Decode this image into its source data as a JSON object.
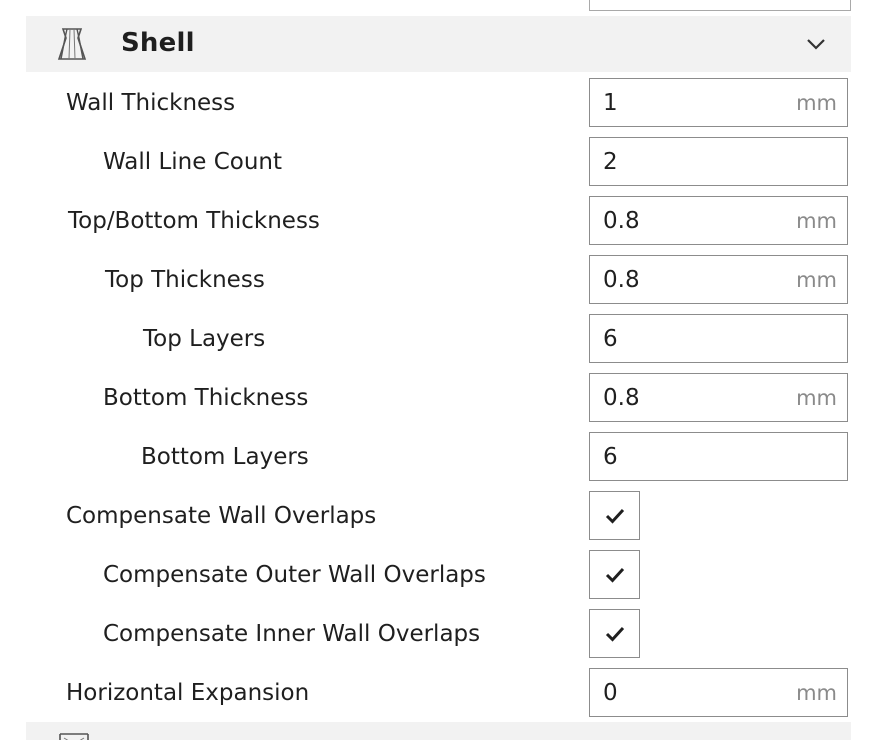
{
  "section": {
    "title": "Shell",
    "icon": "shell-icon",
    "expanded": true
  },
  "settings": [
    {
      "label": "Wall Thickness",
      "level": 0,
      "type": "number",
      "value": "1",
      "unit": "mm"
    },
    {
      "label": "Wall Line Count",
      "level": 1,
      "type": "number",
      "value": "2",
      "unit": ""
    },
    {
      "label": "Top/Bottom Thickness",
      "level": 0,
      "type": "number",
      "value": "0.8",
      "unit": "mm"
    },
    {
      "label": "Top Thickness",
      "level": 1,
      "type": "number",
      "value": "0.8",
      "unit": "mm"
    },
    {
      "label": "Top Layers",
      "level": 2,
      "type": "number",
      "value": "6",
      "unit": ""
    },
    {
      "label": "Bottom Thickness",
      "level": 1,
      "type": "number",
      "value": "0.8",
      "unit": "mm"
    },
    {
      "label": "Bottom Layers",
      "level": 2,
      "type": "number",
      "value": "6",
      "unit": ""
    },
    {
      "label": "Compensate Wall Overlaps",
      "level": 0,
      "type": "checkbox",
      "checked": true
    },
    {
      "label": "Compensate Outer Wall Overlaps",
      "level": 1,
      "type": "checkbox",
      "checked": true
    },
    {
      "label": "Compensate Inner Wall Overlaps",
      "level": 1,
      "type": "checkbox",
      "checked": true
    },
    {
      "label": "Horizontal Expansion",
      "level": 0,
      "type": "number",
      "value": "0",
      "unit": "mm"
    }
  ]
}
